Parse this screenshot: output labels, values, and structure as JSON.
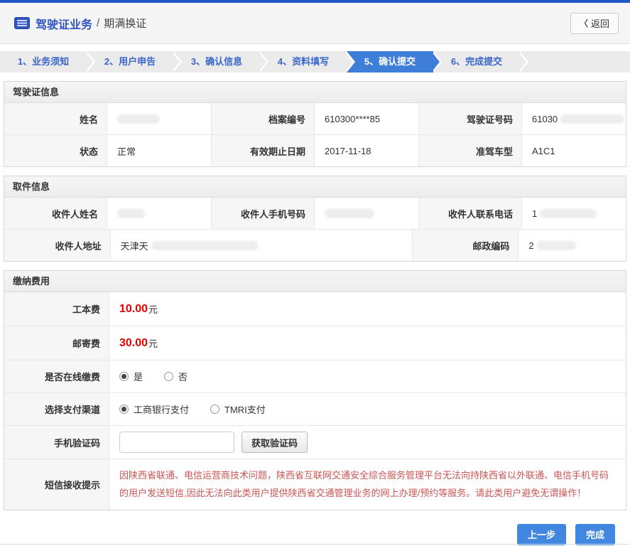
{
  "header": {
    "title": "驾驶证业务",
    "separator": "/",
    "subtitle": "期满换证",
    "back_chevron": "〈",
    "back_label": "返回"
  },
  "steps": [
    {
      "label": "1、业务须知",
      "active": false
    },
    {
      "label": "2、用户申告",
      "active": false
    },
    {
      "label": "3、确认信息",
      "active": false
    },
    {
      "label": "4、资料填写",
      "active": false
    },
    {
      "label": "5、确认提交",
      "active": true
    },
    {
      "label": "6、完成提交",
      "active": false
    }
  ],
  "license": {
    "title": "驾驶证信息",
    "rows": [
      [
        {
          "label": "姓名",
          "value": "",
          "redacted": true
        },
        {
          "label": "档案编号",
          "value": "610300****85",
          "redacted": false
        },
        {
          "label": "驾驶证号码",
          "value": "61030",
          "redacted": true
        }
      ],
      [
        {
          "label": "状态",
          "value": "正常",
          "redacted": false
        },
        {
          "label": "有效期止日期",
          "value": "2017-11-18",
          "redacted": false
        },
        {
          "label": "准驾车型",
          "value": "A1C1",
          "redacted": false
        }
      ]
    ]
  },
  "pickup": {
    "title": "取件信息",
    "rows": [
      [
        {
          "label": "收件人姓名",
          "value": "",
          "redacted": true
        },
        {
          "label": "收件人手机号码",
          "value": "",
          "redacted": true
        },
        {
          "label": "收件人联系电话",
          "value": "1",
          "redacted": true
        }
      ],
      [
        {
          "label": "收件人地址",
          "value": "天津天",
          "redacted": true
        },
        {
          "label": "邮政编码",
          "value": "2",
          "redacted": true
        }
      ]
    ]
  },
  "payment": {
    "title": "缴纳费用",
    "fees": [
      {
        "label": "工本费",
        "amount": "10.00",
        "unit": "元"
      },
      {
        "label": "邮寄费",
        "amount": "30.00",
        "unit": "元"
      }
    ],
    "online": {
      "label": "是否在线缴费",
      "options": [
        {
          "label": "是",
          "checked": true
        },
        {
          "label": "否",
          "checked": false
        }
      ]
    },
    "channel": {
      "label": "选择支付渠道",
      "options": [
        {
          "label": "工商银行支付",
          "checked": true
        },
        {
          "label": "TMRI支付",
          "checked": false
        }
      ]
    },
    "sms": {
      "label": "手机验证码",
      "input_value": "",
      "button": "获取验证码"
    },
    "notice": {
      "label": "短信接收提示",
      "text": "因陕西省联通、电信运营商技术问题，陕西省互联网交通安全综合服务管理平台无法向持陕西省以外联通、电信手机号码的用户发送短信,因此无法向此类用户提供陕西省交通管理业务的网上办理/预约等服务。请此类用户避免无谓操作！"
    }
  },
  "footer": {
    "prev": "上一步",
    "finish": "完成"
  },
  "colors": {
    "top_accent": "#2056c6",
    "title_blue": "#2f54c0",
    "step_text_blue": "#3a66cc",
    "step_active_bg": "#3e7ed9",
    "fee_red": "#e60000",
    "notice_red": "#cc5555",
    "button_blue": "#4187e0"
  }
}
